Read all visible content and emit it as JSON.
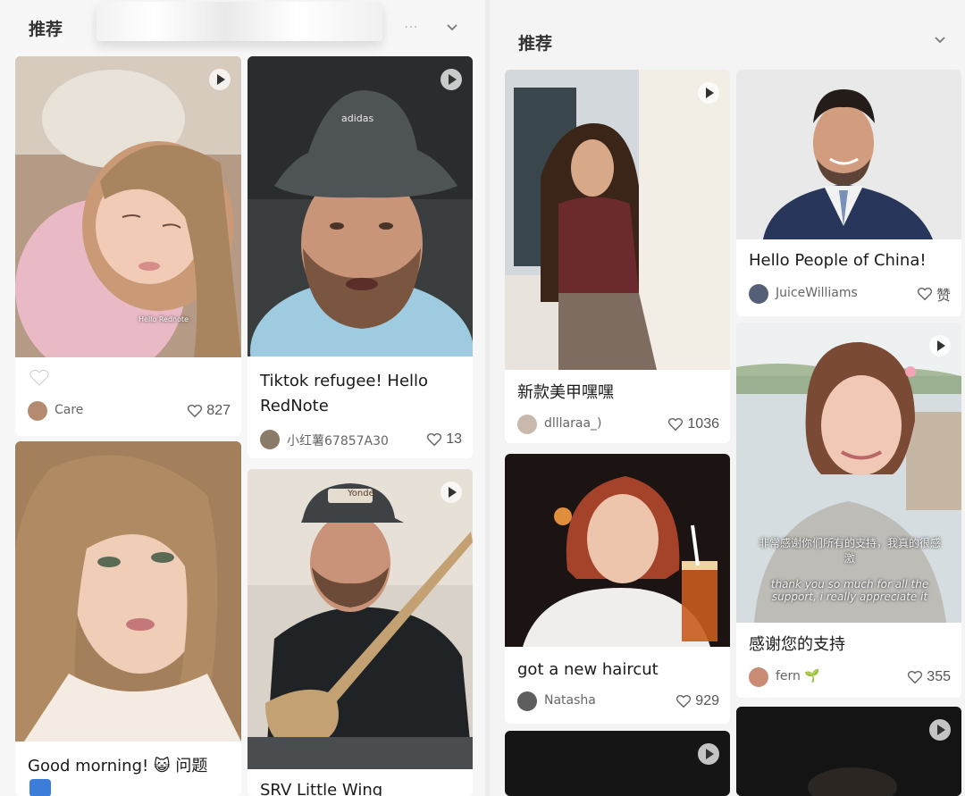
{
  "left_panel": {
    "tab": "推荐",
    "cards": [
      {
        "title": "",
        "author": "Care",
        "likes": "827",
        "overlay_text": "Hello Rednote"
      },
      {
        "title": "Tiktok refugee! Hello RedNote",
        "author": "小红薯67857A30",
        "likes": "13",
        "hat_text": "adidas"
      },
      {
        "title": "Good morning! 😺 问题",
        "author": "",
        "likes": "",
        "emoji_extra": "⤵️"
      },
      {
        "title": "SRV Little Wing",
        "author": "",
        "likes": "",
        "hat_text": "Yonder"
      }
    ]
  },
  "right_panel": {
    "tab": "推荐",
    "cards": [
      {
        "title": "新款美甲嘿嘿",
        "author": "dlllaraa_)",
        "likes": "1036"
      },
      {
        "title": "Hello People of China!",
        "author": "JuiceWilliams",
        "likes": "赞"
      },
      {
        "title": "got a new haircut",
        "author": "Natasha",
        "likes": "929"
      },
      {
        "title": "感谢您的支持",
        "author": "fern 🌱",
        "likes": "355",
        "caption_cn": "非常感谢你们所有的支持，我真的很感激",
        "caption_en": "thank you so much for all the support, i really appreciate it"
      },
      {
        "title": "",
        "author": "",
        "likes": ""
      },
      {
        "title": "",
        "author": "",
        "likes": ""
      }
    ]
  },
  "colors": {
    "background": "#f7f7f7",
    "card": "#ffffff",
    "text": "#1a1a1a",
    "muted": "#666666"
  }
}
